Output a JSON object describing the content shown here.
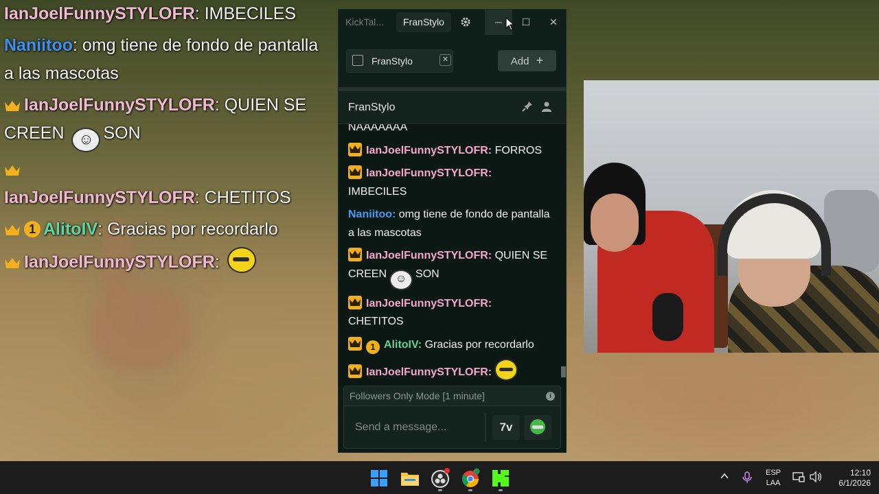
{
  "overlay_chat": [
    {
      "badges": [],
      "user": "IanJoelFunnySTYLOFR",
      "user_color": "#f1b9d1",
      "text": "IMBECILES"
    },
    {
      "badges": [],
      "user": "Naniitoo",
      "user_color": "#3f8ff0",
      "text": "omg tiene de fondo de pantalla a las mascotas"
    },
    {
      "badges": [
        "crown"
      ],
      "user": "IanJoelFunnySTYLOFR",
      "user_color": "#f1b9d1",
      "text_before": "QUIEN SE CREEN",
      "emote": "trollface-emote",
      "text_after": "SON"
    },
    {
      "badges": [
        "crown"
      ],
      "user": "IanJoelFunnySTYLOFR",
      "user_color": "#f1b9d1",
      "text": "CHETITOS"
    },
    {
      "badges": [
        "crown",
        "1"
      ],
      "user": "AlitoIV",
      "user_color": "#5fd6a0",
      "text": "Gracias por recordarlo"
    },
    {
      "badges": [
        "crown"
      ],
      "user": "IanJoelFunnySTYLOFR",
      "user_color": "#f1b9d1",
      "emote": "bee-emote"
    }
  ],
  "app": {
    "titlebar": {
      "inactive_tab": "KickTal...",
      "active_tab": "FranStylo",
      "settings_icon": "gear-icon",
      "minimize": "─",
      "maximize": "☐",
      "close": "✕"
    },
    "channel_tabs": [
      {
        "label": "FranStylo",
        "close": "✕"
      }
    ],
    "add_button": "Add",
    "add_icon": "+",
    "chat_header": {
      "title": "FranStylo",
      "icons": [
        "pin-icon",
        "user-icon"
      ]
    },
    "messages": {
      "m0_text": "NAAAAAAA",
      "m1_user": "IanJoelFunnySTYLOFR:",
      "m1_text": "FORROS",
      "m2_user": "IanJoelFunnySTYLOFR:",
      "m2_text": "IMBECILES",
      "m3_user": "Naniitoo:",
      "m3_text": "omg tiene de fondo de pantalla a las mascotas",
      "m4_user": "IanJoelFunnySTYLOFR:",
      "m4_text_before": "QUIEN SE CREEN",
      "m4_text_after": "SON",
      "m5_user": "IanJoelFunnySTYLOFR:",
      "m5_text": "CHETITOS",
      "m6_badge_num": "1",
      "m6_user": "AlitoIV:",
      "m6_text": "Gracias por recordarlo",
      "m7_user": "IanJoelFunnySTYLOFR:"
    },
    "followers_mode": "Followers Only Mode [1 minute]",
    "input_placeholder": "Send a message...",
    "seventv_label": "7v",
    "colors": {
      "background": "#0d1a16",
      "user_pink": "#f5a7c9",
      "user_blue": "#4a9af5",
      "user_green": "#64d29c",
      "badge_gold": "#f2b01e"
    }
  },
  "taskbar": {
    "apps": [
      "windows-start-icon",
      "file-explorer-icon",
      "obs-icon",
      "chrome-icon",
      "kick-icon"
    ],
    "lang_top": "ESP",
    "lang_bottom": "LAA",
    "time": "12:10",
    "date": "6/1/2026"
  }
}
